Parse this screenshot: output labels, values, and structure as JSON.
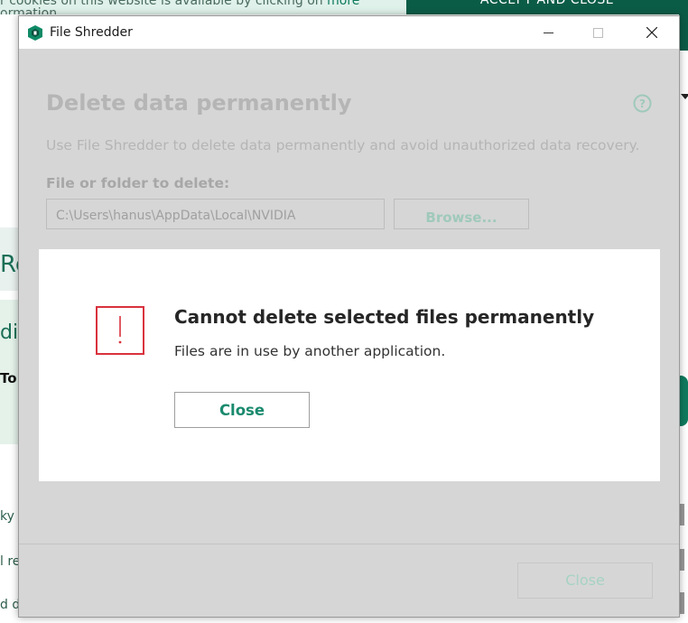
{
  "background": {
    "cookie_text_line1": "r cookies on this website is available by clicking on",
    "cookie_more_link": "more",
    "cookie_text_line2": "ormation",
    "accept_button": "ACCEPT AND CLOSE",
    "fragments": [
      "Re",
      "di",
      "To",
      "ky",
      "l re",
      "d di"
    ]
  },
  "window": {
    "title": "File Shredder",
    "minimize": "—",
    "maximize": "☐",
    "close": "✕"
  },
  "main": {
    "heading": "Delete data permanently",
    "description": "Use File Shredder to delete data permanently and avoid unauthorized data recovery.",
    "field_label": "File or folder to delete:",
    "path_value": "C:\\Users\\hanus\\AppData\\Local\\NVIDIA",
    "browse_label": "Browse...",
    "footer_close_label": "Close"
  },
  "modal": {
    "title": "Cannot delete selected files permanently",
    "message": "Files are in use by another application.",
    "close_label": "Close"
  },
  "colors": {
    "accent": "#1a8a6e",
    "error": "#d9323d",
    "overlay": "#d6d6d6"
  }
}
